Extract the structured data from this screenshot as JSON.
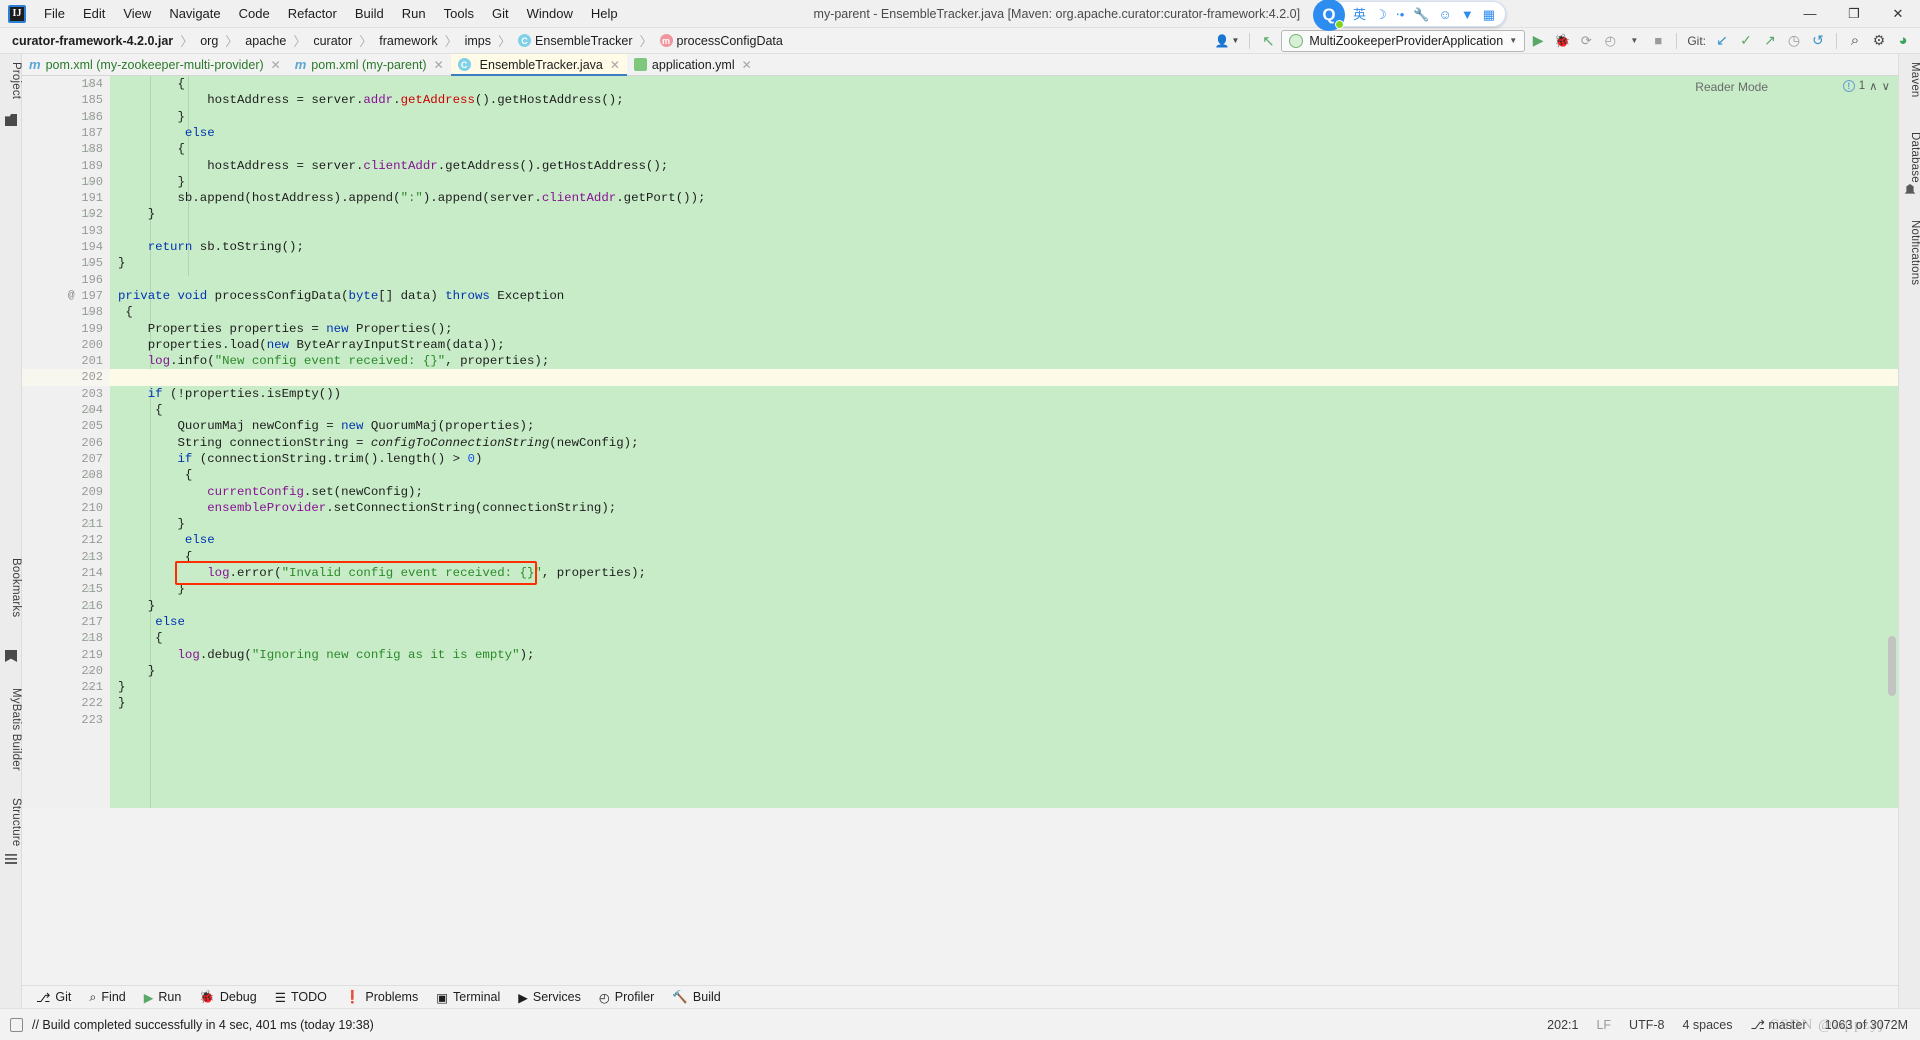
{
  "window": {
    "title": "my-parent - EnsembleTracker.java [Maven: org.apache.curator:curator-framework:4.2.0]",
    "logo": "IJ",
    "minimize_label": "—",
    "restore_label": "❐",
    "close_label": "✕"
  },
  "menubar": {
    "items": [
      {
        "label": "File"
      },
      {
        "label": "Edit"
      },
      {
        "label": "View"
      },
      {
        "label": "Navigate"
      },
      {
        "label": "Code"
      },
      {
        "label": "Refactor"
      },
      {
        "label": "Build"
      },
      {
        "label": "Run"
      },
      {
        "label": "Tools"
      },
      {
        "label": "Git"
      },
      {
        "label": "Window"
      },
      {
        "label": "Help"
      }
    ]
  },
  "ime": {
    "logo": "Q",
    "icons": [
      "英",
      "☽",
      "‧•",
      "🔧",
      "☺",
      "▼",
      "▦"
    ],
    "labels": [
      "chinese-english-toggle",
      "moon-icon",
      "punctuation-icon",
      "wrench-icon",
      "emoji-icon",
      "skin-icon",
      "grid-icon"
    ]
  },
  "breadcrumb": {
    "items": [
      {
        "label": "curator-framework-4.2.0.jar",
        "icon": "",
        "bold": true
      },
      {
        "label": "org",
        "icon": ""
      },
      {
        "label": "apache",
        "icon": ""
      },
      {
        "label": "curator",
        "icon": ""
      },
      {
        "label": "framework",
        "icon": ""
      },
      {
        "label": "imps",
        "icon": ""
      },
      {
        "label": "EnsembleTracker",
        "icon": "C"
      },
      {
        "label": "processConfigData",
        "icon": "m"
      }
    ],
    "separator": "〉"
  },
  "toolbar": {
    "user_icon": "👤",
    "updates_icon": "↖",
    "run_config": "MultiZookeeperProviderApplication",
    "run_config_caret": "▼",
    "run_icon": "▶",
    "debug_icon": "🐞",
    "coverage_icon": "⟳",
    "profile_icon": "◴",
    "profile_caret": "▼",
    "stop_icon": "■",
    "git_label": "Git:",
    "git_update_icon": "↙",
    "git_commit_icon": "✓",
    "git_push_icon": "↗",
    "git_history_icon": "◷",
    "git_rollback_icon": "↺",
    "search_icon": "⌕",
    "settings_icon": "⚙",
    "assistant_icon": "◕"
  },
  "tabs": [
    {
      "label": "pom.xml (my-zookeeper-multi-provider)",
      "icon": "m",
      "kind": "xml",
      "active": false,
      "close": "✕"
    },
    {
      "label": "pom.xml (my-parent)",
      "icon": "m",
      "kind": "xml",
      "active": false,
      "close": "✕"
    },
    {
      "label": "EnsembleTracker.java",
      "icon": "C",
      "kind": "java",
      "active": true,
      "close": "✕"
    },
    {
      "label": "application.yml",
      "icon": "Y",
      "kind": "yml",
      "active": false,
      "close": "✕"
    }
  ],
  "editor": {
    "reader_mode": "Reader Mode",
    "inspection_count": "1",
    "inspection_icon": "!",
    "inspection_up": "∧",
    "inspection_down": "∨",
    "caret_line": 202,
    "first_line": 184,
    "highlight": {
      "line": 214,
      "color": "#ff2d00",
      "text": "log.error(\"Invalid config event received: {}\", properties);"
    },
    "lines": [
      {
        "n": 184,
        "fold": "-",
        "text": "        {"
      },
      {
        "n": 185,
        "fold": "",
        "text": "            hostAddress = server.addr.getAddress().getHostAddress();"
      },
      {
        "n": 186,
        "fold": "+",
        "text": "        }"
      },
      {
        "n": 187,
        "fold": "",
        "text": "         else"
      },
      {
        "n": 188,
        "fold": "-",
        "text": "        {"
      },
      {
        "n": 189,
        "fold": "",
        "text": "            hostAddress = server.clientAddr.getAddress().getHostAddress();"
      },
      {
        "n": 190,
        "fold": "+",
        "text": "        }"
      },
      {
        "n": 191,
        "fold": "",
        "text": "        sb.append(hostAddress).append(\":\").append(server.clientAddr.getPort());"
      },
      {
        "n": 192,
        "fold": "+",
        "text": "    }"
      },
      {
        "n": 193,
        "fold": "",
        "text": ""
      },
      {
        "n": 194,
        "fold": "",
        "text": "    return sb.toString();"
      },
      {
        "n": 195,
        "fold": "+",
        "text": "}"
      },
      {
        "n": 196,
        "fold": "",
        "text": ""
      },
      {
        "n": 197,
        "fold": "",
        "at": "@",
        "text": "private void processConfigData(byte[] data) throws Exception"
      },
      {
        "n": 198,
        "fold": "-",
        "text": " {"
      },
      {
        "n": 199,
        "fold": "",
        "text": "    Properties properties = new Properties();"
      },
      {
        "n": 200,
        "fold": "",
        "text": "    properties.load(new ByteArrayInputStream(data));"
      },
      {
        "n": 201,
        "fold": "",
        "text": "    log.info(\"New config event received: {}\", properties);"
      },
      {
        "n": 202,
        "fold": "",
        "text": ""
      },
      {
        "n": 203,
        "fold": "",
        "text": "    if (!properties.isEmpty())"
      },
      {
        "n": 204,
        "fold": "-",
        "text": "     {"
      },
      {
        "n": 205,
        "fold": "",
        "text": "        QuorumMaj newConfig = new QuorumMaj(properties);"
      },
      {
        "n": 206,
        "fold": "",
        "text": "        String connectionString = configToConnectionString(newConfig);"
      },
      {
        "n": 207,
        "fold": "",
        "text": "        if (connectionString.trim().length() > 0)"
      },
      {
        "n": 208,
        "fold": "-",
        "text": "         {"
      },
      {
        "n": 209,
        "fold": "",
        "text": "            currentConfig.set(newConfig);"
      },
      {
        "n": 210,
        "fold": "",
        "text": "            ensembleProvider.setConnectionString(connectionString);"
      },
      {
        "n": 211,
        "fold": "+",
        "text": "        }"
      },
      {
        "n": 212,
        "fold": "",
        "text": "         else"
      },
      {
        "n": 213,
        "fold": "-",
        "text": "         {"
      },
      {
        "n": 214,
        "fold": "",
        "text": "            log.error(\"Invalid config event received: {}\", properties);"
      },
      {
        "n": 215,
        "fold": "+",
        "text": "        }"
      },
      {
        "n": 216,
        "fold": "+",
        "text": "    }"
      },
      {
        "n": 217,
        "fold": "",
        "text": "     else"
      },
      {
        "n": 218,
        "fold": "-",
        "text": "     {"
      },
      {
        "n": 219,
        "fold": "",
        "text": "        log.debug(\"Ignoring new config as it is empty\");"
      },
      {
        "n": 220,
        "fold": "+",
        "text": "    }"
      },
      {
        "n": 221,
        "fold": "+",
        "text": "}"
      },
      {
        "n": 222,
        "fold": "",
        "text": "}"
      },
      {
        "n": 223,
        "fold": "",
        "text": ""
      }
    ]
  },
  "left_strip": {
    "items": [
      {
        "label": "Project",
        "icon": "project-icon"
      },
      {
        "label": "Bookmarks",
        "icon": "bookmark-icon"
      },
      {
        "label": "MyBatis Builder",
        "icon": ""
      },
      {
        "label": "Structure",
        "icon": "structure-icon"
      }
    ]
  },
  "right_strip": {
    "items": [
      {
        "label": "Maven",
        "icon": "maven-icon"
      },
      {
        "label": "Database",
        "icon": "database-icon"
      },
      {
        "label": "Notifications",
        "icon": "bell-icon"
      }
    ]
  },
  "bottom_tools": [
    {
      "label": "Git",
      "icon": "⎇"
    },
    {
      "label": "Find",
      "icon": "⌕"
    },
    {
      "label": "Run",
      "icon": "▶"
    },
    {
      "label": "Debug",
      "icon": "🐞"
    },
    {
      "label": "TODO",
      "icon": "☰"
    },
    {
      "label": "Problems",
      "icon": "❗"
    },
    {
      "label": "Terminal",
      "icon": "▣"
    },
    {
      "label": "Services",
      "icon": "▶"
    },
    {
      "label": "Profiler",
      "icon": "◴"
    },
    {
      "label": "Build",
      "icon": "🔨"
    }
  ],
  "status": {
    "message": "// Build completed successfully in 4 sec, 401 ms (today 19:38)",
    "caret_position": "202:1",
    "line_separator": "LF",
    "encoding": "UTF-8",
    "indent": "4 spaces",
    "branch_icon": "⎇",
    "branch": "master",
    "memory": "1063 of 3072M",
    "watermark": "CSDN @zqipzyj"
  }
}
